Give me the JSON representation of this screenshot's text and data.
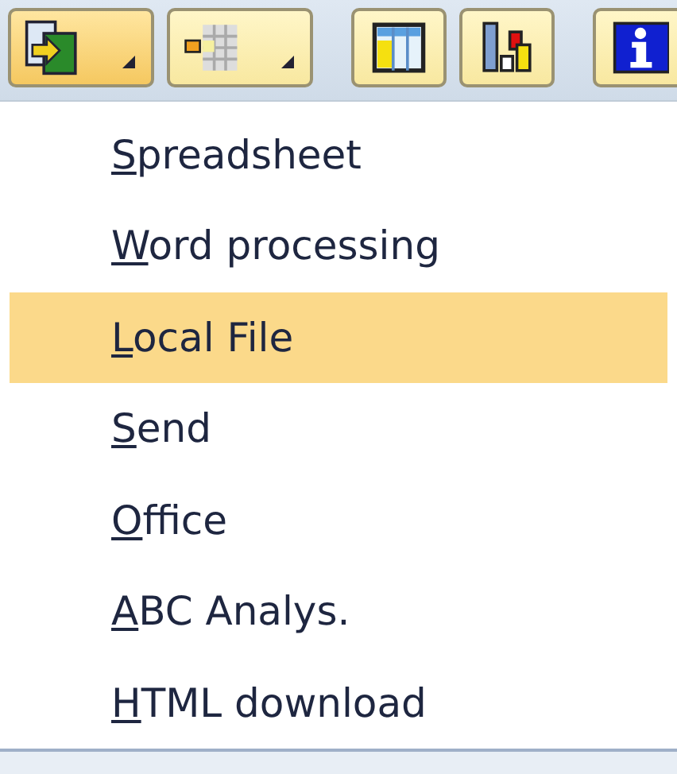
{
  "toolbar": [
    {
      "kind": "dropdown",
      "pressed": true
    },
    {
      "kind": "dropdown",
      "pressed": false
    },
    {
      "kind": "separator"
    },
    {
      "kind": "plain",
      "pressed": false
    },
    {
      "kind": "plain",
      "pressed": false
    },
    {
      "kind": "separator"
    },
    {
      "kind": "plain",
      "pressed": false
    }
  ],
  "menu": {
    "items": [
      {
        "label": "Spreadsheet",
        "selected": false
      },
      {
        "label": "Word processing",
        "selected": false
      },
      {
        "label": "Local File",
        "selected": true
      },
      {
        "label": "Send",
        "selected": false
      },
      {
        "label": "Office",
        "selected": false
      },
      {
        "label": "ABC Analys.",
        "selected": false
      },
      {
        "label": "HTML download",
        "selected": false
      }
    ]
  }
}
